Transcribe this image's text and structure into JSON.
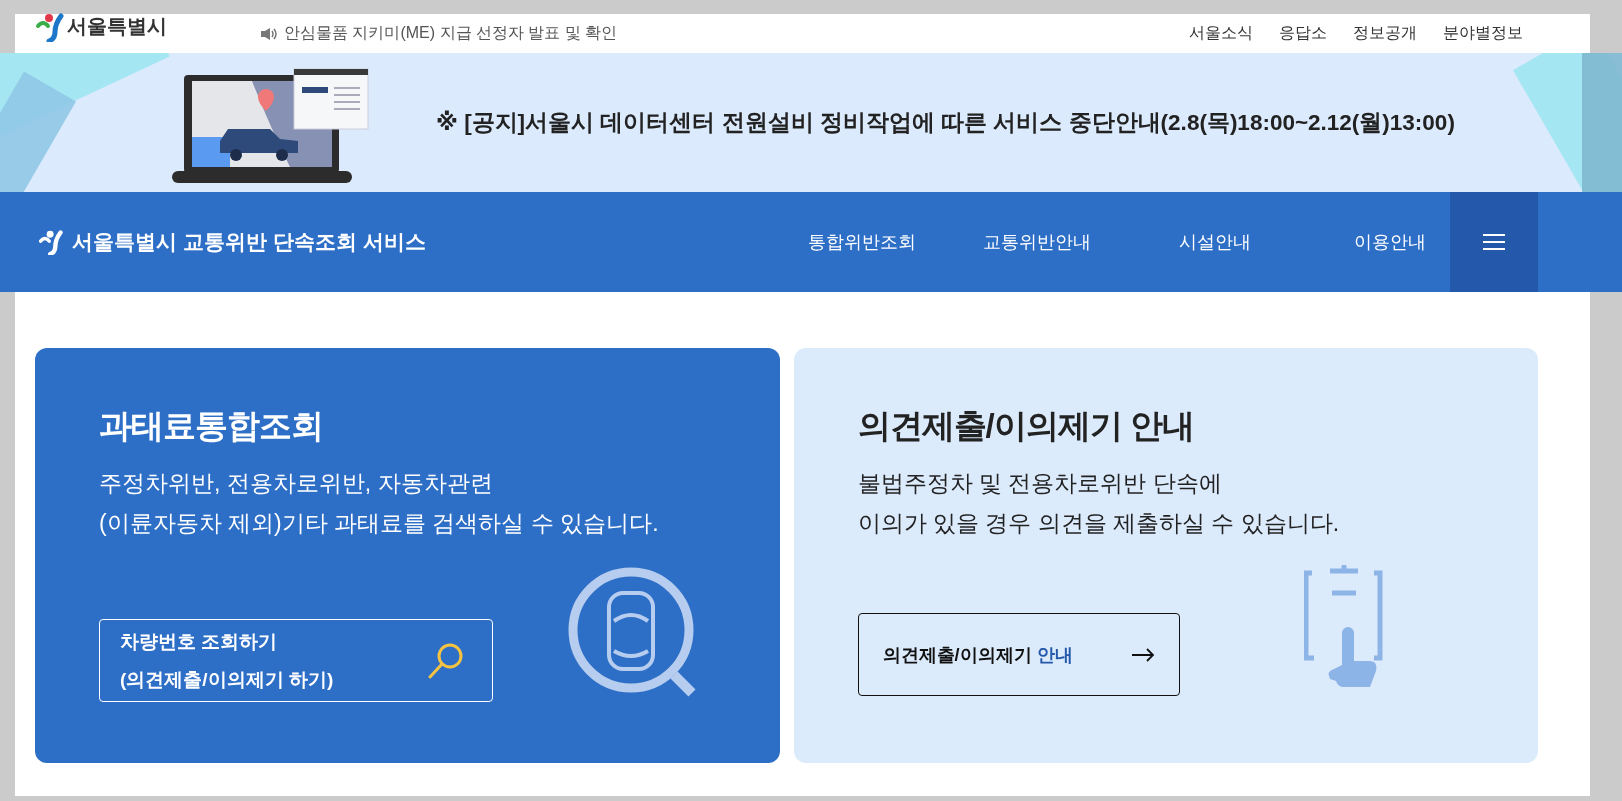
{
  "top_bar": {
    "logo_text": "서울특별시",
    "notice": "안심물품 지키미(ME) 지급 선정자 발표 및 확인",
    "links": [
      "서울소식",
      "응답소",
      "정보공개",
      "분야별정보"
    ]
  },
  "banner": {
    "notice": "※ [공지]서울시 데이터센터 전원설비 정비작업에 따른 서비스 중단안내(2.8(목)18:00~2.12(월)13:00)"
  },
  "nav": {
    "title": "서울특별시 교통위반 단속조회 서비스",
    "items": [
      "통합위반조회",
      "교통위반안내",
      "시설안내",
      "이용안내"
    ]
  },
  "cards": [
    {
      "kind": "lookup",
      "title": "과태료통합조회",
      "lines": [
        "주정차위반, 전용차로위반, 자동차관련",
        "(이륜자동차 제외)기타 과태료를 검색하실 수 있습니다."
      ],
      "button": {
        "lines": [
          "차량번호 조회하기",
          "(의견제출/이의제기 하기)"
        ]
      }
    },
    {
      "kind": "guide",
      "title": "의견제출/이의제기 안내",
      "lines": [
        "불법주정차 및 전용차로위반 단속에",
        "이의가 있을 경우 의견을 제출하실 수 있습니다."
      ],
      "button": {
        "lines": [
          "의견제출/이의제기",
          "안내"
        ]
      }
    }
  ]
}
